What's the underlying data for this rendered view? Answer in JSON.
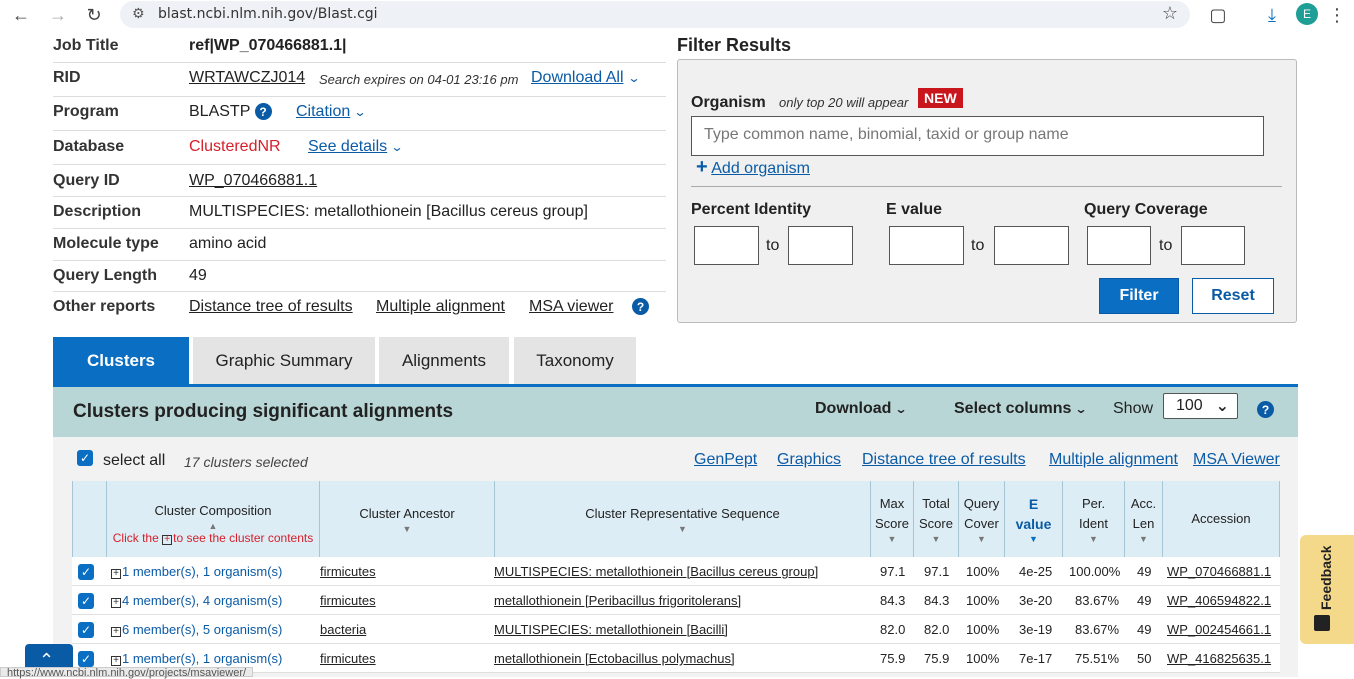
{
  "browser": {
    "url": "blast.ncbi.nlm.nih.gov/Blast.cgi",
    "avatar_letter": "E"
  },
  "job": {
    "rows": [
      {
        "label": "Job Title",
        "value": "ref|WP_070466881.1|"
      },
      {
        "label": "RID",
        "value": "WRTAWCZJ014",
        "expiry": "Search expires on 04-01 23:16 pm",
        "action": "Download All"
      },
      {
        "label": "Program",
        "value": "BLASTP",
        "action": "Citation"
      },
      {
        "label": "Database",
        "value": "ClusteredNR",
        "action": "See details"
      },
      {
        "label": "Query ID",
        "value": "WP_070466881.1"
      },
      {
        "label": "Description",
        "value": "MULTISPECIES: metallothionein [Bacillus cereus group]"
      },
      {
        "label": "Molecule type",
        "value": "amino acid"
      },
      {
        "label": "Query Length",
        "value": "49"
      },
      {
        "label": "Other reports",
        "links": [
          "Distance tree of results",
          "Multiple alignment",
          "MSA viewer"
        ]
      }
    ]
  },
  "filter": {
    "title": "Filter Results",
    "organism_label": "Organism",
    "organism_hint": "only top 20 will appear",
    "new_badge": "NEW",
    "organism_placeholder": "Type common  name, binomial, taxid or group  name",
    "add_organism": "Add organism",
    "percent_identity": "Percent Identity",
    "e_value": "E value",
    "query_coverage": "Query Coverage",
    "to": "to",
    "filter_button": "Filter",
    "reset_button": "Reset"
  },
  "tabs": [
    "Clusters",
    "Graphic Summary",
    "Alignments",
    "Taxonomy"
  ],
  "results": {
    "title": "Clusters producing significant alignments",
    "download": "Download",
    "select_columns": "Select columns",
    "show": "Show",
    "show_value": "100",
    "select_all": "select all",
    "selected_count": "17 clusters selected",
    "links": [
      "GenPept",
      "Graphics",
      "Distance tree of results",
      "Multiple alignment",
      "MSA Viewer"
    ],
    "columns": {
      "cluster_composition": "Cluster Composition",
      "click_hint_pre": "Click the",
      "click_hint_post": "to see the cluster contents",
      "cluster_ancestor": "Cluster Ancestor",
      "representative": "Cluster Representative Sequence",
      "max_score_1": "Max",
      "max_score_2": "Score",
      "total_score_1": "Total",
      "total_score_2": "Score",
      "query_cover_1": "Query",
      "query_cover_2": "Cover",
      "e_value_1": "E",
      "e_value_2": "value",
      "per_ident_1": "Per.",
      "per_ident_2": "Ident",
      "acc_len_1": "Acc.",
      "acc_len_2": "Len",
      "accession": "Accession"
    },
    "rows": [
      {
        "composition": "1 member(s), 1 organism(s)",
        "ancestor": "firmicutes",
        "representative": "MULTISPECIES: metallothionein [Bacillus cereus group]",
        "max": "97.1",
        "total": "97.1",
        "cover": "100%",
        "evalue": "4e-25",
        "ident": "100.00%",
        "len": "49",
        "accession": "WP_070466881.1"
      },
      {
        "composition": "4 member(s), 4 organism(s)",
        "ancestor": "firmicutes",
        "representative": "metallothionein [Peribacillus frigoritolerans]",
        "max": "84.3",
        "total": "84.3",
        "cover": "100%",
        "evalue": "3e-20",
        "ident": "83.67%",
        "len": "49",
        "accession": "WP_406594822.1"
      },
      {
        "composition": "6 member(s), 5 organism(s)",
        "ancestor": "bacteria",
        "representative": "MULTISPECIES: metallothionein [Bacilli]",
        "max": "82.0",
        "total": "82.0",
        "cover": "100%",
        "evalue": "3e-19",
        "ident": "83.67%",
        "len": "49",
        "accession": "WP_002454661.1"
      },
      {
        "composition": "1 member(s), 1 organism(s)",
        "ancestor": "firmicutes",
        "representative": "metallothionein [Ectobacillus polymachus]",
        "max": "75.9",
        "total": "75.9",
        "cover": "100%",
        "evalue": "7e-17",
        "ident": "75.51%",
        "len": "50",
        "accession": "WP_416825635.1"
      }
    ]
  },
  "feedback": "Feedback",
  "status_url": "https://www.ncbi.nlm.nih.gov/projects/msaviewer/"
}
